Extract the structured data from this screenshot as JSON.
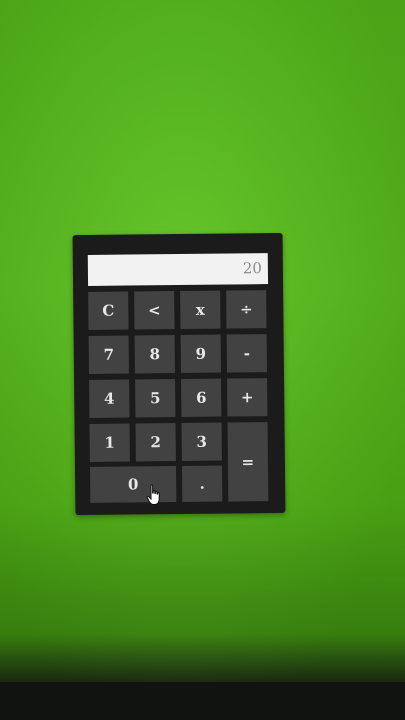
{
  "calculator": {
    "display_value": "20",
    "keys": {
      "clear": "C",
      "back": "<",
      "multiply": "x",
      "divide": "÷",
      "seven": "7",
      "eight": "8",
      "nine": "9",
      "minus": "-",
      "four": "4",
      "five": "5",
      "six": "6",
      "plus": "+",
      "one": "1",
      "two": "2",
      "three": "3",
      "equals": "=",
      "zero": "0",
      "decimal": "."
    }
  },
  "colors": {
    "background": "#5cc21e",
    "panel": "#1b1b1b",
    "key": "#424242",
    "key_text": "#e8e8e8",
    "display": "#f2f2f2",
    "display_text": "#8a8a8a"
  },
  "icons": {
    "cursor": "hand-pointer-icon"
  }
}
